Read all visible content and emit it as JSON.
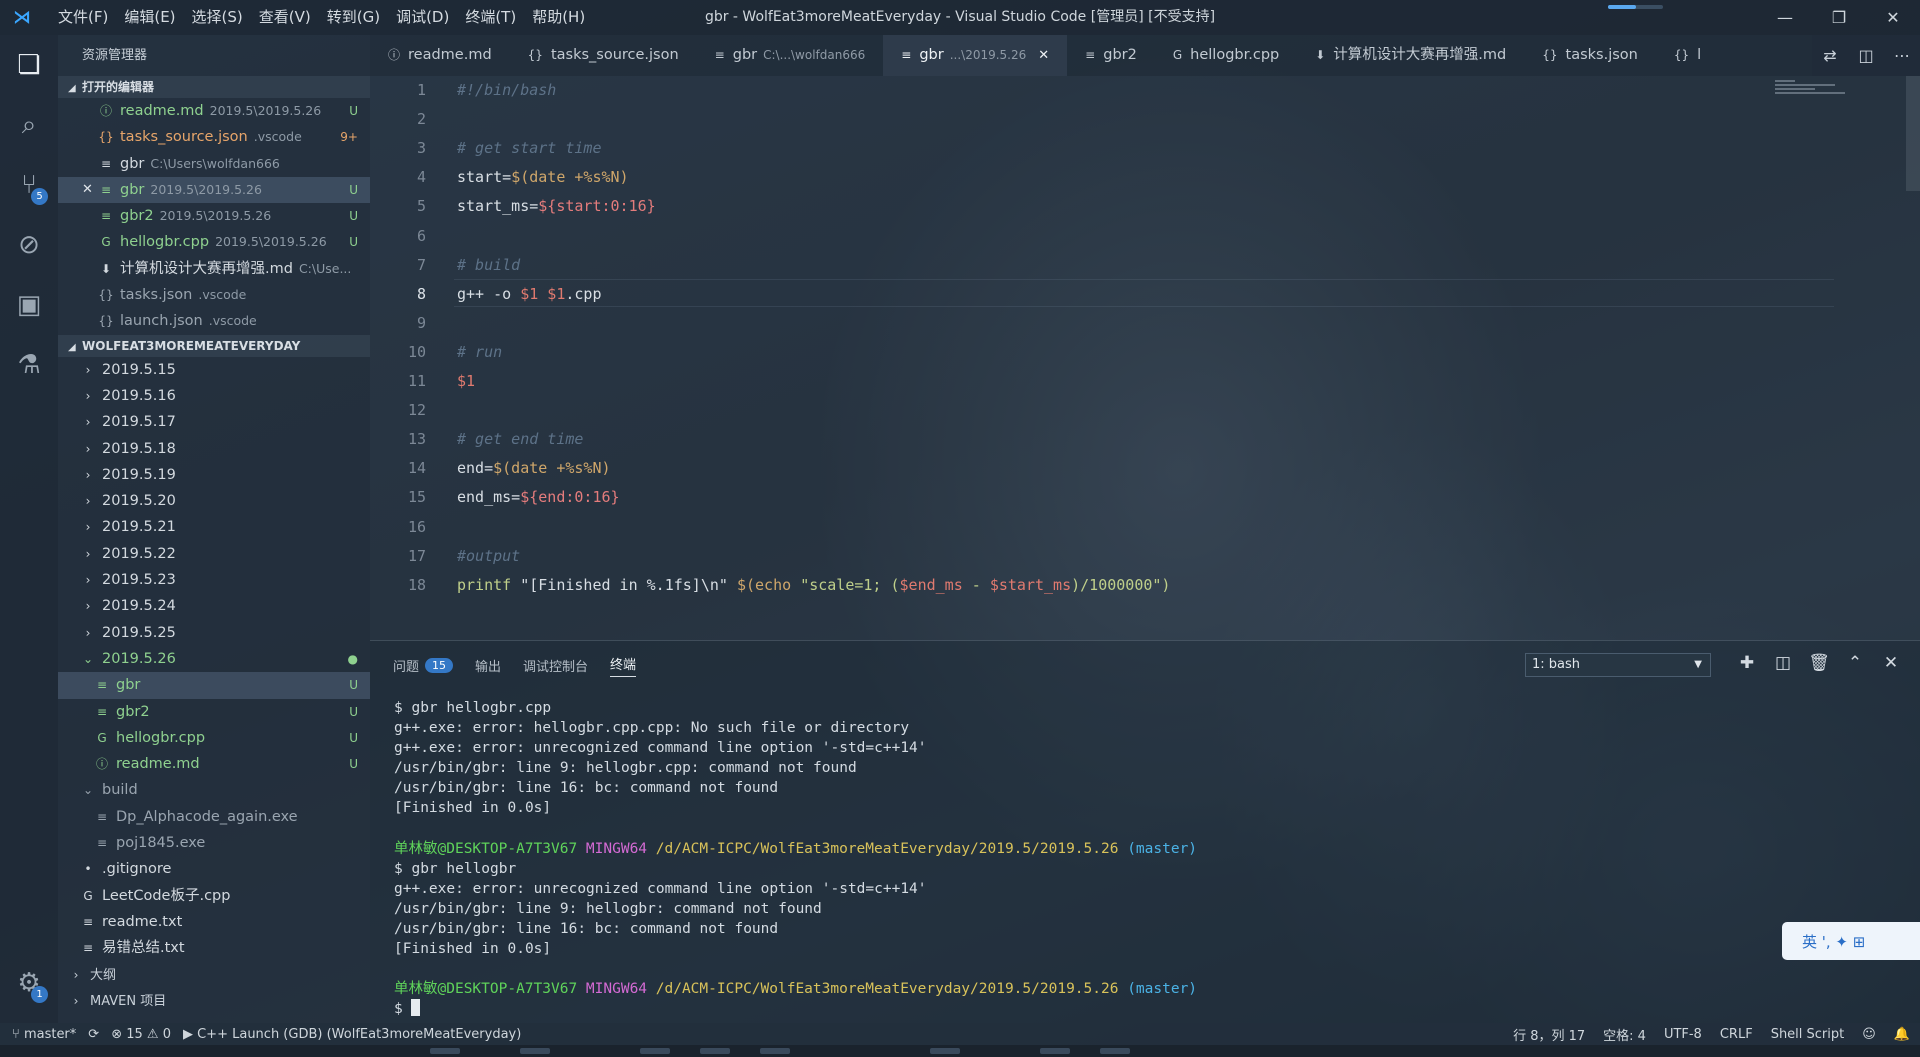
{
  "window": {
    "title": "gbr - WolfEat3moreMeatEveryday - Visual Studio Code [管理员] [不受支持]"
  },
  "menu": [
    "文件(F)",
    "编辑(E)",
    "选择(S)",
    "查看(V)",
    "转到(G)",
    "调试(D)",
    "终端(T)",
    "帮助(H)"
  ],
  "activity": {
    "scm_badge": "5",
    "settings_badge": "1"
  },
  "sidebar": {
    "title": "资源管理器",
    "open_editors_header": "打开的编辑器",
    "open_editors": [
      {
        "icon": "ⓘ",
        "name": "readme.md",
        "desc": "2019.5\\2019.5.26",
        "status": "U",
        "cls": "c-u"
      },
      {
        "icon": "{}",
        "name": "tasks_source.json",
        "desc": ".vscode",
        "status": "9+",
        "cls": "c-warn"
      },
      {
        "icon": "≡",
        "name": "gbr",
        "desc": "C:\\Users\\wolfdan666",
        "status": "",
        "cls": "c-plain"
      },
      {
        "icon": "≡",
        "name": "gbr",
        "desc": "2019.5\\2019.5.26",
        "status": "U",
        "cls": "c-u"
      },
      {
        "icon": "≡",
        "name": "gbr2",
        "desc": "2019.5\\2019.5.26",
        "status": "U",
        "cls": "c-u"
      },
      {
        "icon": "G",
        "name": "hellogbr.cpp",
        "desc": "2019.5\\2019.5.26",
        "status": "U",
        "cls": "c-u"
      },
      {
        "icon": "⬇",
        "name": "计算机设计大赛再增强.md",
        "desc": "C:\\Use...",
        "status": "",
        "cls": "c-plain"
      },
      {
        "icon": "{}",
        "name": "tasks.json",
        "desc": ".vscode",
        "status": "",
        "cls": "c-ign"
      },
      {
        "icon": "{}",
        "name": "launch.json",
        "desc": ".vscode",
        "status": "",
        "cls": "c-ign"
      }
    ],
    "folder_header": "WOLFEAT3MOREMEATEVERYDAY",
    "tree": [
      {
        "indent": 1,
        "arrow": "›",
        "name": "2019.5.15",
        "status": "",
        "cls": "c-plain"
      },
      {
        "indent": 1,
        "arrow": "›",
        "name": "2019.5.16",
        "status": "",
        "cls": "c-plain"
      },
      {
        "indent": 1,
        "arrow": "›",
        "name": "2019.5.17",
        "status": "",
        "cls": "c-plain"
      },
      {
        "indent": 1,
        "arrow": "›",
        "name": "2019.5.18",
        "status": "",
        "cls": "c-plain"
      },
      {
        "indent": 1,
        "arrow": "›",
        "name": "2019.5.19",
        "status": "",
        "cls": "c-plain"
      },
      {
        "indent": 1,
        "arrow": "›",
        "name": "2019.5.20",
        "status": "",
        "cls": "c-plain"
      },
      {
        "indent": 1,
        "arrow": "›",
        "name": "2019.5.21",
        "status": "",
        "cls": "c-plain"
      },
      {
        "indent": 1,
        "arrow": "›",
        "name": "2019.5.22",
        "status": "",
        "cls": "c-plain"
      },
      {
        "indent": 1,
        "arrow": "›",
        "name": "2019.5.23",
        "status": "",
        "cls": "c-plain"
      },
      {
        "indent": 1,
        "arrow": "›",
        "name": "2019.5.24",
        "status": "",
        "cls": "c-plain"
      },
      {
        "indent": 1,
        "arrow": "›",
        "name": "2019.5.25",
        "status": "",
        "cls": "c-plain"
      },
      {
        "indent": 1,
        "arrow": "⌄",
        "name": "2019.5.26",
        "status": "●",
        "cls": "c-u"
      },
      {
        "indent": 2,
        "arrow": "",
        "icon": "≡",
        "name": "gbr",
        "status": "U",
        "cls": "c-u",
        "selected": true
      },
      {
        "indent": 2,
        "arrow": "",
        "icon": "≡",
        "name": "gbr2",
        "status": "U",
        "cls": "c-u"
      },
      {
        "indent": 2,
        "arrow": "",
        "icon": "G",
        "name": "hellogbr.cpp",
        "status": "U",
        "cls": "c-u"
      },
      {
        "indent": 2,
        "arrow": "",
        "icon": "ⓘ",
        "name": "readme.md",
        "status": "U",
        "cls": "c-u"
      },
      {
        "indent": 1,
        "arrow": "⌄",
        "name": "build",
        "status": "",
        "cls": "c-ign"
      },
      {
        "indent": 2,
        "arrow": "",
        "icon": "≡",
        "name": "Dp_Alphacode_again.exe",
        "status": "",
        "cls": "c-ign"
      },
      {
        "indent": 2,
        "arrow": "",
        "icon": "≡",
        "name": "poj1845.exe",
        "status": "",
        "cls": "c-ign"
      },
      {
        "indent": 1,
        "arrow": "",
        "icon": "•",
        "name": ".gitignore",
        "status": "",
        "cls": "c-plain"
      },
      {
        "indent": 1,
        "arrow": "",
        "icon": "G",
        "name": "LeetCode板子.cpp",
        "status": "",
        "cls": "c-plain"
      },
      {
        "indent": 1,
        "arrow": "",
        "icon": "≡",
        "name": "readme.txt",
        "status": "",
        "cls": "c-plain"
      },
      {
        "indent": 1,
        "arrow": "",
        "icon": "≡",
        "name": "易错总结.txt",
        "status": "",
        "cls": "c-plain"
      }
    ],
    "outline_header": "大纲",
    "maven_header": "MAVEN 项目"
  },
  "tabs": [
    {
      "icon": "ⓘ",
      "label": "readme.md",
      "sub": "",
      "active": false
    },
    {
      "icon": "{}",
      "label": "tasks_source.json",
      "sub": "",
      "active": false
    },
    {
      "icon": "≡",
      "label": "gbr",
      "sub": "C:\\...\\wolfdan666",
      "active": false
    },
    {
      "icon": "≡",
      "label": "gbr",
      "sub": "...\\2019.5.26",
      "active": true
    },
    {
      "icon": "≡",
      "label": "gbr2",
      "sub": "",
      "active": false
    },
    {
      "icon": "G",
      "label": "hellogbr.cpp",
      "sub": "",
      "active": false
    },
    {
      "icon": "⬇",
      "label": "计算机设计大赛再增强.md",
      "sub": "",
      "active": false
    },
    {
      "icon": "{}",
      "label": "tasks.json",
      "sub": "",
      "active": false
    },
    {
      "icon": "{}",
      "label": "l",
      "sub": "",
      "active": false
    }
  ],
  "editor": {
    "current_line": 8,
    "lines": [
      [
        {
          "t": "#!/bin/bash",
          "c": "tk-c"
        }
      ],
      [],
      [
        {
          "t": "# get start time",
          "c": "tk-c"
        }
      ],
      [
        {
          "t": "start=",
          "c": "tk-p"
        },
        {
          "t": "$(date +%s%N)",
          "c": "tk-o"
        }
      ],
      [
        {
          "t": "start_ms=",
          "c": "tk-p"
        },
        {
          "t": "${start:0:16}",
          "c": "tk-s"
        }
      ],
      [],
      [
        {
          "t": "# build",
          "c": "tk-c"
        }
      ],
      [
        {
          "t": "g++ -o ",
          "c": "tk-p"
        },
        {
          "t": "$1 $1",
          "c": "tk-v"
        },
        {
          "t": ".cpp",
          "c": "tk-p"
        }
      ],
      [],
      [
        {
          "t": "# run",
          "c": "tk-c"
        }
      ],
      [
        {
          "t": "$1",
          "c": "tk-v"
        }
      ],
      [],
      [
        {
          "t": "# get end time",
          "c": "tk-c"
        }
      ],
      [
        {
          "t": "end=",
          "c": "tk-p"
        },
        {
          "t": "$(date +%s%N)",
          "c": "tk-o"
        }
      ],
      [
        {
          "t": "end_ms=",
          "c": "tk-p"
        },
        {
          "t": "${end:0:16}",
          "c": "tk-s"
        }
      ],
      [],
      [
        {
          "t": "#output",
          "c": "tk-c"
        }
      ],
      [
        {
          "t": "printf ",
          "c": "tk-str"
        },
        {
          "t": "\"[Finished in %.1fs]\\n\" ",
          "c": "tk-p"
        },
        {
          "t": "$(echo ",
          "c": "tk-o"
        },
        {
          "t": "\"scale=1; (",
          "c": "tk-str"
        },
        {
          "t": "$end_ms",
          "c": "tk-v"
        },
        {
          "t": " - ",
          "c": "tk-str"
        },
        {
          "t": "$start_ms",
          "c": "tk-v"
        },
        {
          "t": ")/1000000\")",
          "c": "tk-str"
        }
      ]
    ]
  },
  "panel": {
    "tabs": [
      "问题",
      "输出",
      "调试控制台",
      "终端"
    ],
    "problems_count": "15",
    "terminal_select": "1: bash",
    "terminal": [
      [
        {
          "t": "$ gbr hellogbr.cpp"
        }
      ],
      [
        {
          "t": "g++.exe: error: hellogbr.cpp.cpp: No such file or directory"
        }
      ],
      [
        {
          "t": "g++.exe: error: unrecognized command line option '-std=c++14'"
        }
      ],
      [
        {
          "t": "/usr/bin/gbr: line 9: hellogbr.cpp: command not found"
        }
      ],
      [
        {
          "t": "/usr/bin/gbr: line 16: bc: command not found"
        }
      ],
      [
        {
          "t": "[Finished in 0.0s]"
        }
      ],
      [],
      [
        {
          "t": "单林敏@DESKTOP-A7T3V67",
          "c": "t-user"
        },
        {
          "t": " "
        },
        {
          "t": "MINGW64",
          "c": "t-ming"
        },
        {
          "t": " "
        },
        {
          "t": "/d/ACM-ICPC/WolfEat3moreMeatEveryday/2019.5/2019.5.26",
          "c": "t-path"
        },
        {
          "t": " "
        },
        {
          "t": "(master)",
          "c": "t-br"
        }
      ],
      [
        {
          "t": "$ gbr hellogbr"
        }
      ],
      [
        {
          "t": "g++.exe: error: unrecognized command line option '-std=c++14'"
        }
      ],
      [
        {
          "t": "/usr/bin/gbr: line 9: hellogbr: command not found"
        }
      ],
      [
        {
          "t": "/usr/bin/gbr: line 16: bc: command not found"
        }
      ],
      [
        {
          "t": "[Finished in 0.0s]"
        }
      ],
      [],
      [
        {
          "t": "单林敏@DESKTOP-A7T3V67",
          "c": "t-user"
        },
        {
          "t": " "
        },
        {
          "t": "MINGW64",
          "c": "t-ming"
        },
        {
          "t": " "
        },
        {
          "t": "/d/ACM-ICPC/WolfEat3moreMeatEveryday/2019.5/2019.5.26",
          "c": "t-path"
        },
        {
          "t": " "
        },
        {
          "t": "(master)",
          "c": "t-br"
        }
      ],
      [
        {
          "t": "$ "
        },
        {
          "cursor": true
        }
      ]
    ]
  },
  "ime": {
    "label": "英 ', ✦ ⊞"
  },
  "status": {
    "branch": "master*",
    "errors": "15",
    "warnings": "0",
    "launch": "C++ Launch (GDB) (WolfEat3moreMeatEveryday)",
    "position": "行 8，列 17",
    "spaces": "空格: 4",
    "encoding": "UTF-8",
    "eol": "CRLF",
    "language": "Shell Script"
  }
}
